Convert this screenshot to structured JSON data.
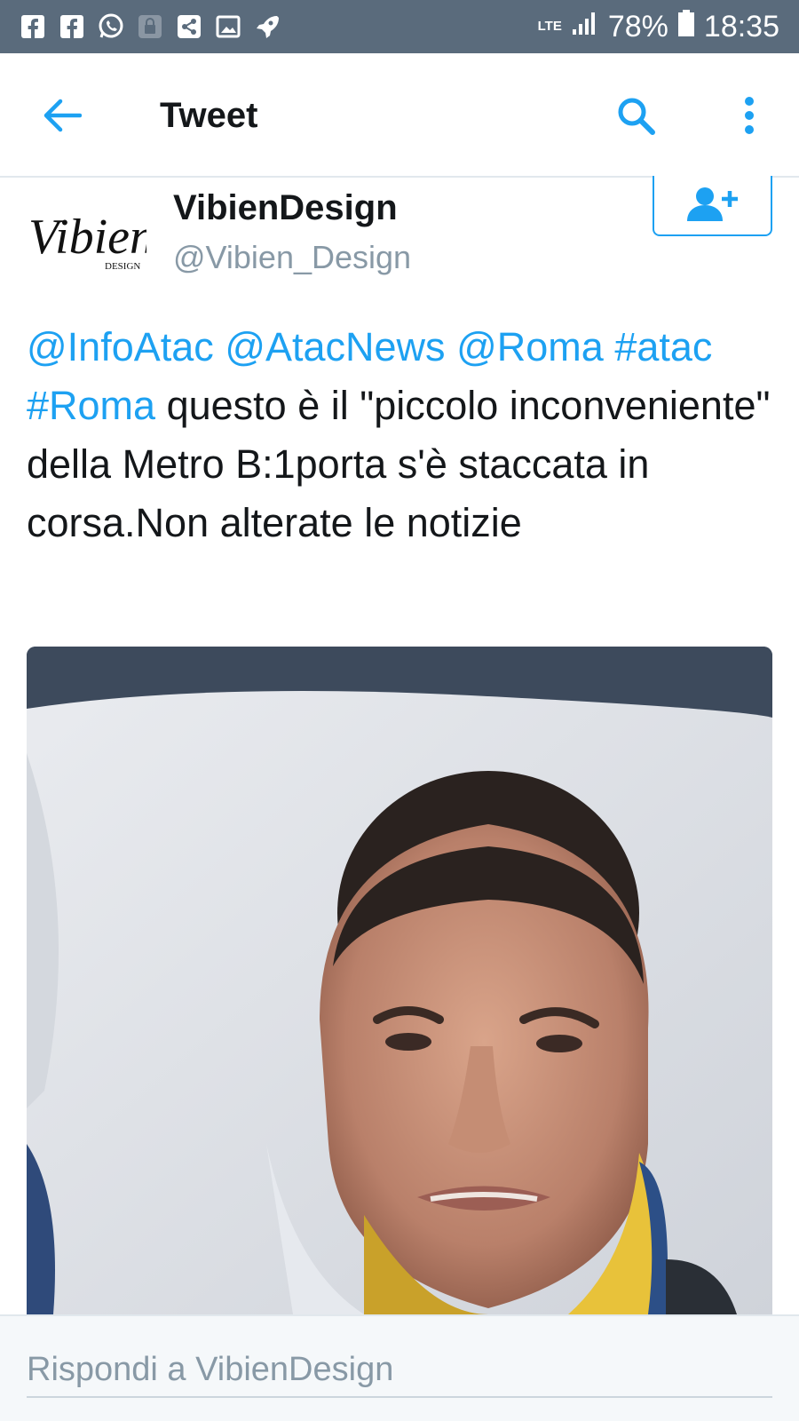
{
  "status_bar": {
    "icons": [
      "facebook-icon",
      "facebook-icon",
      "whatsapp-icon",
      "lock-icon",
      "share-icon",
      "image-icon",
      "rocket-icon"
    ],
    "network": "LTE",
    "battery": "78%",
    "time": "18:35"
  },
  "app_bar": {
    "title": "Tweet"
  },
  "tweet": {
    "author": {
      "display_name": "VibienDesign",
      "handle": "@Vibien_Design",
      "avatar_text": "Vibien",
      "avatar_subtext": "DESIGN"
    },
    "text_parts": [
      {
        "type": "mention",
        "text": "@InfoAtac"
      },
      {
        "type": "plain",
        "text": " "
      },
      {
        "type": "mention",
        "text": "@AtacNews"
      },
      {
        "type": "plain",
        "text": " "
      },
      {
        "type": "mention",
        "text": "@Roma"
      },
      {
        "type": "plain",
        "text": " "
      },
      {
        "type": "hashtag",
        "text": "#atac"
      },
      {
        "type": "plain",
        "text": " "
      },
      {
        "type": "hashtag",
        "text": "#Roma"
      },
      {
        "type": "plain",
        "text": " questo è il \"piccolo inconveniente\" della Metro B:1porta s'è staccata in corsa.Non alterate le notizie"
      }
    ]
  },
  "reply": {
    "placeholder": "Rispondi a VibienDesign"
  },
  "colors": {
    "accent": "#1da1f2",
    "status_bar": "#5a6b7c",
    "secondary_text": "#8899a6"
  }
}
